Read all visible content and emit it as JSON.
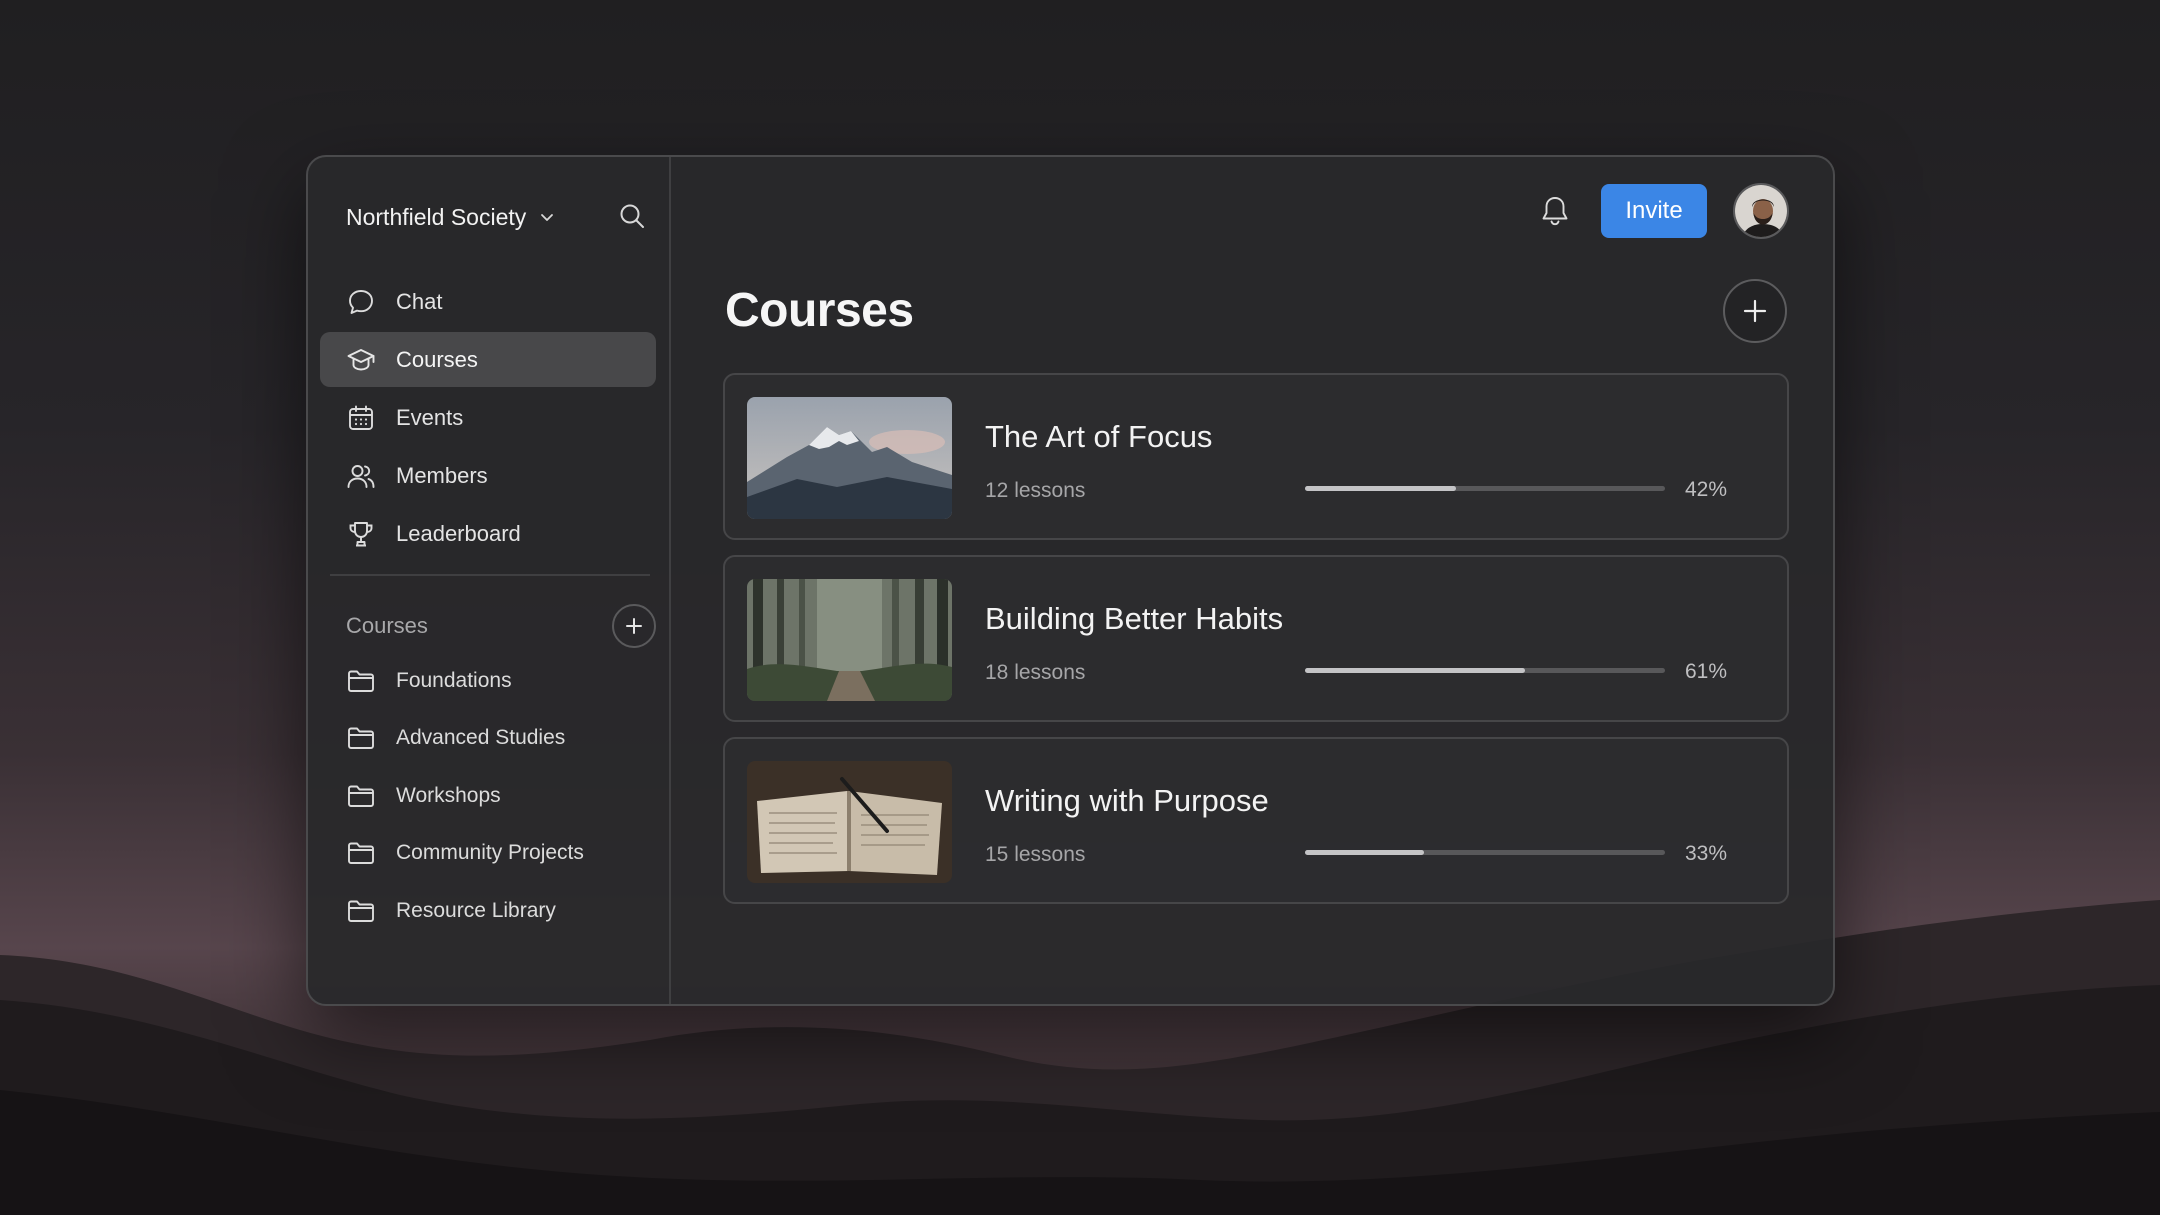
{
  "workspace": {
    "name": "Northfield Society"
  },
  "nav": {
    "items": [
      {
        "label": "Chat",
        "icon": "chat-bubble-icon",
        "active": false
      },
      {
        "label": "Courses",
        "icon": "graduation-cap-icon",
        "active": true
      },
      {
        "label": "Events",
        "icon": "calendar-icon",
        "active": false
      },
      {
        "label": "Members",
        "icon": "members-icon",
        "active": false
      },
      {
        "label": "Leaderboard",
        "icon": "trophy-icon",
        "active": false
      }
    ]
  },
  "course_folders": {
    "title": "Courses",
    "items": [
      {
        "label": "Foundations",
        "icon": "folder-icon"
      },
      {
        "label": "Advanced Studies",
        "icon": "folder-icon"
      },
      {
        "label": "Workshops",
        "icon": "folder-icon"
      },
      {
        "label": "Community Projects",
        "icon": "folder-icon"
      },
      {
        "label": "Resource Library",
        "icon": "folder-icon"
      }
    ]
  },
  "header": {
    "invite_label": "Invite"
  },
  "page": {
    "title": "Courses"
  },
  "courses": [
    {
      "title": "The Art of Focus",
      "lessons": "12 lessons",
      "progress": 0.42,
      "progress_label": "42%",
      "thumbnail": "mountain-photo"
    },
    {
      "title": "Building Better Habits",
      "lessons": "18 lessons",
      "progress": 0.61,
      "progress_label": "61%",
      "thumbnail": "forest-path-photo"
    },
    {
      "title": "Writing with Purpose",
      "lessons": "15 lessons",
      "progress": 0.33,
      "progress_label": "33%",
      "thumbnail": "open-notebook-photo"
    }
  ],
  "colors": {
    "accent": "#3b86e6",
    "active_nav_bg": "#48484a",
    "progress_fill": "#c4c4c6",
    "progress_track": "#58585a"
  }
}
